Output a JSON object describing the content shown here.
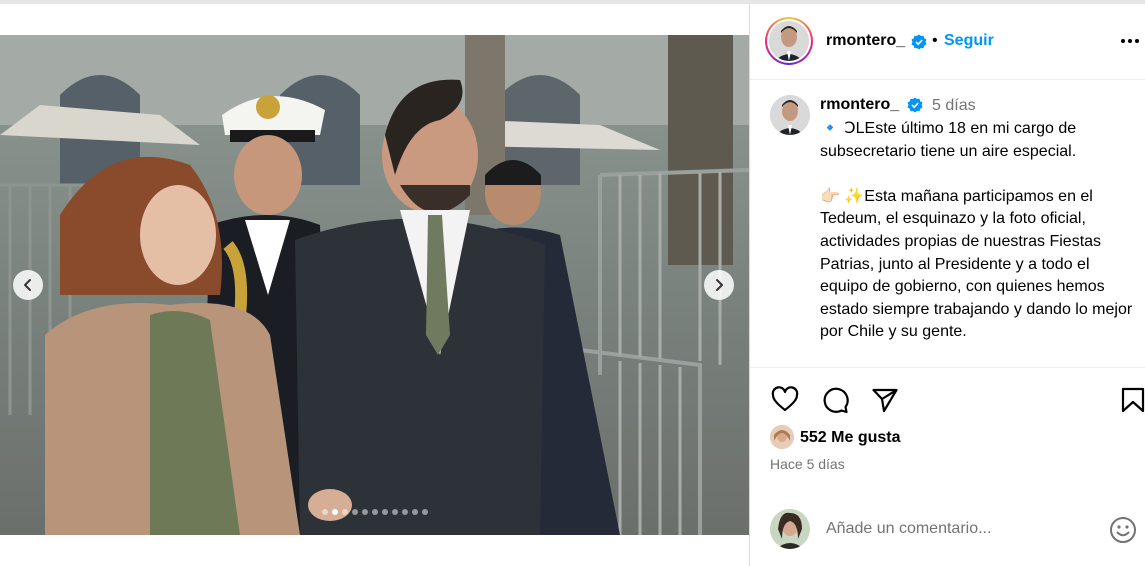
{
  "post": {
    "username": "rmontero_",
    "follow_label": "Seguir",
    "header_separator": "•",
    "time_short": "5 días",
    "caption": "🔹 ꓛLEste último 18 en mi cargo de subsecretario tiene un aire especial.\n\n👉🏻 ✨Esta mañana participamos en el Tedeum, el esquinazo y la foto oficial, actividades propias de nuestras Fiestas Patrias, junto al Presidente y a todo el equipo de gobierno, con quienes hemos estado siempre trabajando y dando lo mejor por Chile y su gente.",
    "likes": "552 Me gusta",
    "time_ago": "Hace 5 días",
    "comment_placeholder": "Añade un comentario..."
  },
  "carousel": {
    "total_slides": 11,
    "active_slide": 2
  },
  "colors": {
    "accent": "#0095f6",
    "muted_text": "#737373",
    "verified": "#0095f6"
  },
  "icons": {
    "like": "heart-icon",
    "comment": "comment-bubble-icon",
    "share": "paper-plane-icon",
    "save": "bookmark-icon",
    "more": "more-dots-icon",
    "emoji": "smiley-icon",
    "prev": "chevron-left-icon",
    "next": "chevron-right-icon",
    "verified": "verified-badge-icon"
  }
}
